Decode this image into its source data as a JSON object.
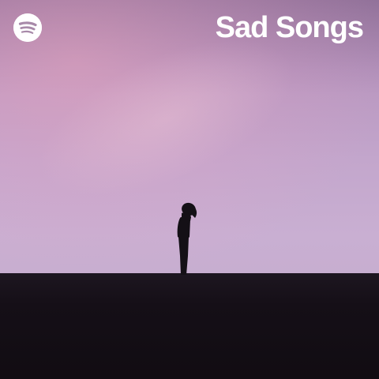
{
  "playlist": {
    "title": "Sad Songs",
    "brand_icon": "spotify-icon"
  },
  "colors": {
    "title_text": "#ffffff",
    "logo": "#ffffff",
    "sky": "#c3a6cc",
    "ground": "#150f17"
  }
}
